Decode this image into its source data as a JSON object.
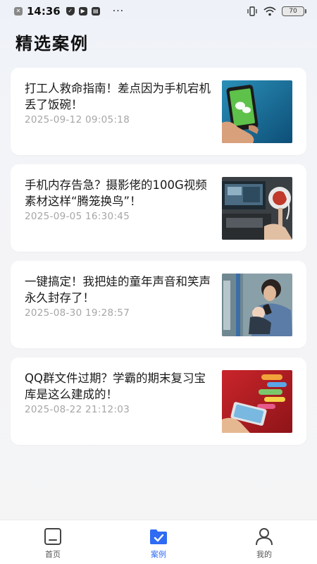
{
  "status_bar": {
    "time": "14:36",
    "more": "···",
    "battery": "70"
  },
  "page": {
    "title": "精选案例"
  },
  "cases": [
    {
      "title": "打工人救命指南！差点因为手机宕机丢了饭碗！",
      "time": "2025-09-12 09:05:18",
      "image": "hand-holding-phone-with-chat-app"
    },
    {
      "title": "手机内存告急？摄影佬的100G视频素材这样“腾笼换鸟”！",
      "time": "2025-09-05 16:30:45",
      "image": "person-editing-video-with-headphones"
    },
    {
      "title": "一键搞定！我把娃的童年声音和笑声永久封存了！",
      "time": "2025-08-30 19:28:57",
      "image": "mother-with-baby-using-phone"
    },
    {
      "title": "QQ群文件过期？学霸的期末复习宝库是这么建成的！",
      "time": "2025-08-22 21:12:03",
      "image": "hand-with-phone-and-chat-bubbles"
    }
  ],
  "tab_bar": {
    "items": [
      {
        "label": "首页",
        "icon": "home-icon",
        "active": false
      },
      {
        "label": "案例",
        "icon": "case-folder-icon",
        "active": true
      },
      {
        "label": "我的",
        "icon": "profile-icon",
        "active": false
      }
    ],
    "active_color": "#2f6bf3"
  }
}
